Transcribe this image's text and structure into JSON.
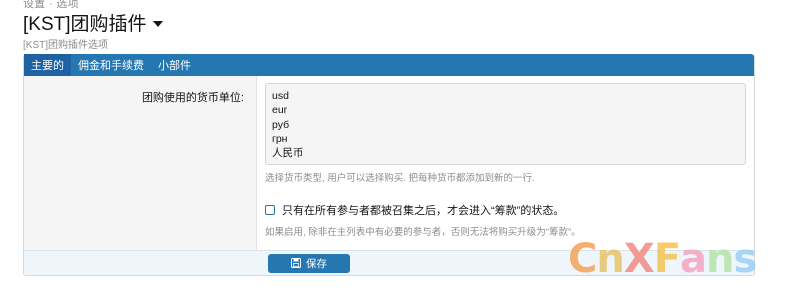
{
  "breadcrumb": "设置 · 选项",
  "title": "[KST]团购插件",
  "subtitle": "[KST]团购插件选项",
  "tabs": [
    "主要的",
    "佣金和手续费",
    "小部件"
  ],
  "currency": {
    "label": "团购使用的货币单位:",
    "values": [
      "usd",
      "eur",
      "руб",
      "грн",
      "人民币"
    ],
    "hint": "选择货币类型, 用户可以选择购买. 把每种货币都添加到新的一行."
  },
  "option": {
    "checkbox_label": "只有在所有参与者都被召集之后，才会进入“筹款”的状态。",
    "checked": false,
    "hint": "如果启用, 除非在主列表中有必要的参与者，否则无法将购买升级为“筹款”。"
  },
  "footer": {
    "save_label": "保存"
  },
  "watermark": {
    "text": [
      "C",
      "n",
      "X",
      "F",
      "a",
      "n",
      "s"
    ]
  },
  "colors": {
    "accent": "#2577b1",
    "tab_active": "#1e62a3"
  }
}
